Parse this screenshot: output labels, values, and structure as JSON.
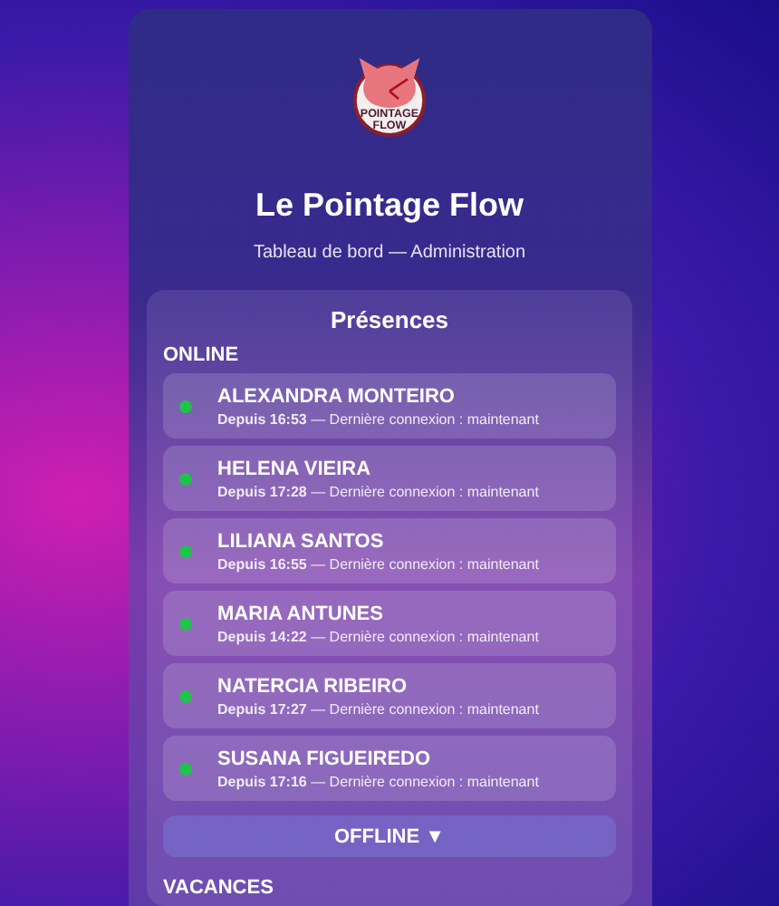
{
  "logo": {
    "lines": [
      "POINTAGE",
      "FLOW"
    ]
  },
  "title": "Le Pointage Flow",
  "subtitle": "Tableau de bord — Administration",
  "panel": {
    "title": "Présences",
    "online": {
      "heading": "ONLINE",
      "users": [
        {
          "name": "ALEXANDRA MONTEIRO",
          "detail": "**Depuis 16:53** — Dernière connexion : maintenant",
          "online": true
        },
        {
          "name": "HELENA VIEIRA",
          "detail": "**Depuis 17:28** — Dernière connexion : maintenant",
          "online": true
        },
        {
          "name": "LILIANA SANTOS",
          "detail": "**Depuis 16:55** — Dernière connexion : maintenant",
          "online": true
        },
        {
          "name": "MARIA ANTUNES",
          "detail": "**Depuis 14:22** — Dernière connexion : maintenant",
          "online": true
        },
        {
          "name": "NATERCIA RIBEIRO",
          "detail": "**Depuis 17:27** — Dernière connexion : maintenant",
          "online": true
        },
        {
          "name": "SUSANA FIGUEIREDO",
          "detail": "**Depuis 17:16** — Dernière connexion : maintenant",
          "online": true
        }
      ]
    },
    "offline": {
      "label": "OFFLINE",
      "caret": "▼",
      "expanded": false
    },
    "vacances": {
      "heading": "VACANCES"
    }
  }
}
